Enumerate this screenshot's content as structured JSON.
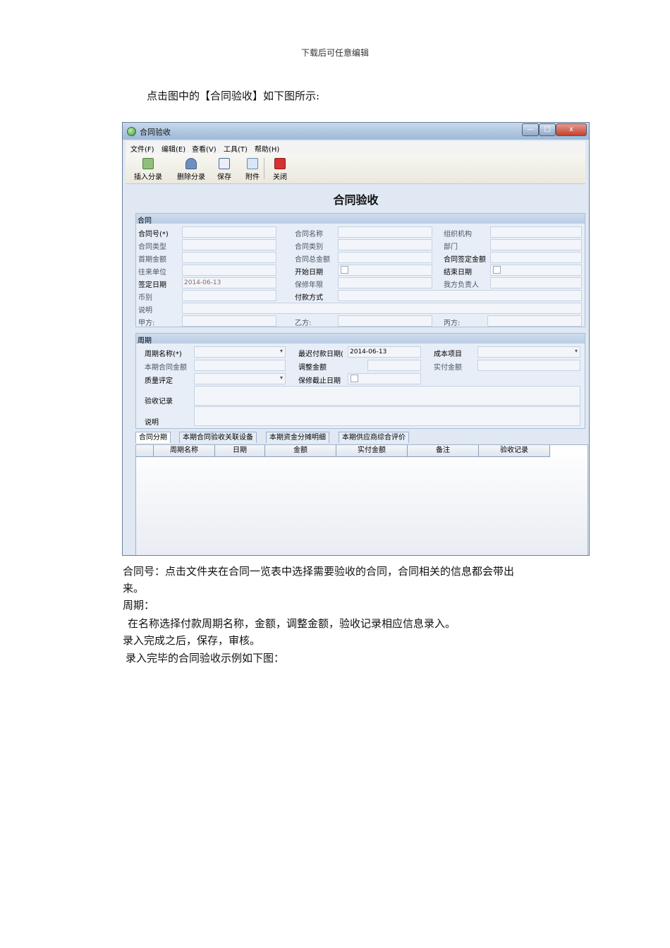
{
  "header": {
    "text": "下载后可任意编辑"
  },
  "intro": "点击图中的【合同验收】如下图所示:",
  "window": {
    "title": "合同验收",
    "controls": {
      "minimize": "—",
      "maximize": "□",
      "close": "x"
    },
    "menu": [
      "文件(F)",
      "编辑(E)",
      "查看(V)",
      "工具(T)",
      "帮助(H)"
    ],
    "toolbar": [
      "插入分录",
      "删除分录",
      "保存",
      "附件",
      "关闭"
    ],
    "form_title": "合同验收",
    "contract_group": {
      "title": "合同",
      "labels": {
        "contract_no": "合同号(*)",
        "contract_name": "合同名称",
        "org": "组织机构",
        "contract_type": "合同类型",
        "contract_category": "合同类别",
        "dept": "部门",
        "first_amount": "首期金额",
        "total_amount": "合同总金额",
        "signed_amount": "合同签定金额",
        "partner": "往来单位",
        "start_date": "开始日期",
        "end_date": "结束日期",
        "sign_date": "签定日期",
        "warranty_years": "保修年限",
        "our_person": "我方负责人",
        "currency": "币别",
        "payment_method": "付款方式",
        "description": "说明",
        "party_a": "甲方:",
        "party_b": "乙方:",
        "party_c": "丙方:"
      },
      "values": {
        "sign_date": "2014-06-13"
      }
    },
    "period_group": {
      "title": "周期",
      "labels": {
        "period_name": "周期名称(*)",
        "latest_pay_date": "最迟付款日期(",
        "cost_item": "成本项目",
        "current_contract_amount": "本期合同金额",
        "adjust_amount": "调整金额",
        "actual_amount": "实付金额",
        "quality": "质量评定",
        "warranty_end": "保修截止日期",
        "acceptance_record": "验收记录",
        "description": "说明"
      },
      "values": {
        "latest_pay_date": "2014-06-13"
      }
    },
    "tabs": [
      "合同分期",
      "本期合同验收关联设备",
      "本期资金分摊明细",
      "本期供应商综合评价"
    ],
    "grid_columns": [
      "周期名称",
      "日期",
      "金额",
      "实付金额",
      "备注",
      "验收记录"
    ]
  },
  "body_text": {
    "line1": "合同号：点击文件夹在合同一览表中选择需要验收的合同，合同相关的信息都会带出",
    "line2": "来。",
    "line3": "周期：",
    "line4": "在名称选择付款周期名称，金额，调整金额，验收记录相应信息录入。",
    "line5": "录入完成之后，保存，审核。",
    "line6": "录入完毕的合同验收示例如下图："
  }
}
